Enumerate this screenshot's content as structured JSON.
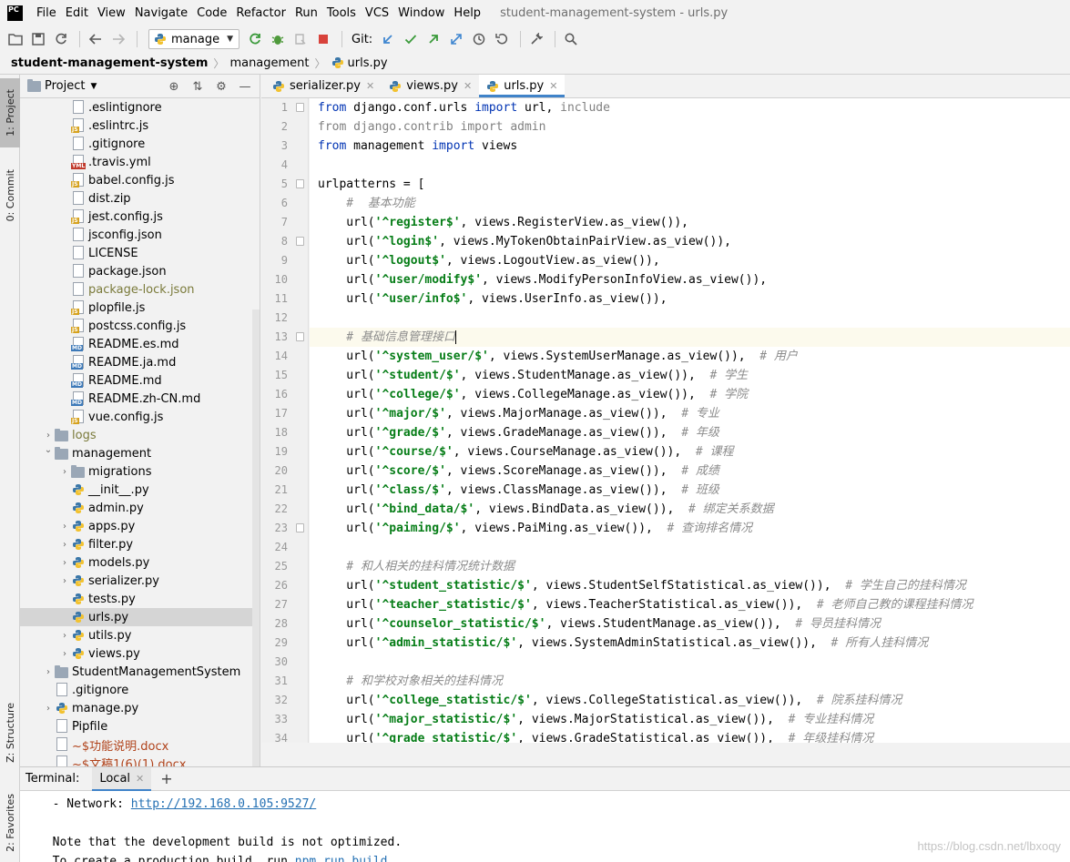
{
  "menu": {
    "logo_text": "PC",
    "items": [
      "File",
      "Edit",
      "View",
      "Navigate",
      "Code",
      "Refactor",
      "Run",
      "Tools",
      "VCS",
      "Window",
      "Help"
    ],
    "window_title": "student-management-system - urls.py"
  },
  "toolbar": {
    "run_config": "manage",
    "git_label": "Git:"
  },
  "breadcrumb": {
    "project": "student-management-system",
    "folder": "management",
    "file": "urls.py"
  },
  "left_stripe": {
    "project_tab": "1: Project",
    "commit_tab": "0: Commit",
    "structure_tab": "Z: Structure",
    "favorites_tab": "2: Favorites"
  },
  "project_panel": {
    "title": "Project",
    "rows": [
      {
        "name": ".eslintignore",
        "indent": 2,
        "kind": "file",
        "badge": "",
        "style": ""
      },
      {
        "name": ".eslintrc.js",
        "indent": 2,
        "kind": "file",
        "badge": "JS",
        "style": ""
      },
      {
        "name": ".gitignore",
        "indent": 2,
        "kind": "file",
        "badge": "",
        "style": ""
      },
      {
        "name": ".travis.yml",
        "indent": 2,
        "kind": "file",
        "badge": "YML",
        "style": ""
      },
      {
        "name": "babel.config.js",
        "indent": 2,
        "kind": "file",
        "badge": "JS",
        "style": ""
      },
      {
        "name": "dist.zip",
        "indent": 2,
        "kind": "file",
        "badge": "",
        "style": ""
      },
      {
        "name": "jest.config.js",
        "indent": 2,
        "kind": "file",
        "badge": "JS",
        "style": ""
      },
      {
        "name": "jsconfig.json",
        "indent": 2,
        "kind": "file",
        "badge": "",
        "style": ""
      },
      {
        "name": "LICENSE",
        "indent": 2,
        "kind": "file",
        "badge": "",
        "style": ""
      },
      {
        "name": "package.json",
        "indent": 2,
        "kind": "file",
        "badge": "",
        "style": ""
      },
      {
        "name": "package-lock.json",
        "indent": 2,
        "kind": "file",
        "badge": "",
        "style": "muted"
      },
      {
        "name": "plopfile.js",
        "indent": 2,
        "kind": "file",
        "badge": "JS",
        "style": ""
      },
      {
        "name": "postcss.config.js",
        "indent": 2,
        "kind": "file",
        "badge": "JS",
        "style": ""
      },
      {
        "name": "README.es.md",
        "indent": 2,
        "kind": "file",
        "badge": "MD",
        "style": ""
      },
      {
        "name": "README.ja.md",
        "indent": 2,
        "kind": "file",
        "badge": "MD",
        "style": ""
      },
      {
        "name": "README.md",
        "indent": 2,
        "kind": "file",
        "badge": "MD",
        "style": ""
      },
      {
        "name": "README.zh-CN.md",
        "indent": 2,
        "kind": "file",
        "badge": "MD",
        "style": ""
      },
      {
        "name": "vue.config.js",
        "indent": 2,
        "kind": "file",
        "badge": "JS",
        "style": ""
      },
      {
        "name": "logs",
        "indent": 1,
        "kind": "folder",
        "arrow": "›",
        "style": "muted"
      },
      {
        "name": "management",
        "indent": 1,
        "kind": "folder",
        "arrow": "⌄",
        "style": ""
      },
      {
        "name": "migrations",
        "indent": 2,
        "kind": "folder",
        "arrow": "›",
        "style": ""
      },
      {
        "name": "__init__.py",
        "indent": 2,
        "kind": "py",
        "style": ""
      },
      {
        "name": "admin.py",
        "indent": 2,
        "kind": "py",
        "style": ""
      },
      {
        "name": "apps.py",
        "indent": 2,
        "kind": "py",
        "arrow": "›",
        "style": ""
      },
      {
        "name": "filter.py",
        "indent": 2,
        "kind": "py",
        "arrow": "›",
        "style": ""
      },
      {
        "name": "models.py",
        "indent": 2,
        "kind": "py",
        "arrow": "›",
        "style": ""
      },
      {
        "name": "serializer.py",
        "indent": 2,
        "kind": "py",
        "arrow": "›",
        "style": ""
      },
      {
        "name": "tests.py",
        "indent": 2,
        "kind": "py",
        "style": ""
      },
      {
        "name": "urls.py",
        "indent": 2,
        "kind": "py",
        "style": "",
        "selected": true
      },
      {
        "name": "utils.py",
        "indent": 2,
        "kind": "py",
        "arrow": "›",
        "style": ""
      },
      {
        "name": "views.py",
        "indent": 2,
        "kind": "py",
        "arrow": "›",
        "style": ""
      },
      {
        "name": "StudentManagementSystem",
        "indent": 1,
        "kind": "folder",
        "arrow": "›",
        "style": ""
      },
      {
        "name": ".gitignore",
        "indent": 1,
        "kind": "file",
        "badge": "",
        "style": ""
      },
      {
        "name": "manage.py",
        "indent": 1,
        "kind": "py",
        "arrow": "›",
        "style": ""
      },
      {
        "name": "Pipfile",
        "indent": 1,
        "kind": "file",
        "badge": "",
        "style": ""
      },
      {
        "name": "~$功能说明.docx",
        "indent": 1,
        "kind": "file",
        "badge": "",
        "style": "red"
      },
      {
        "name": "~$文稿1(6)(1).docx",
        "indent": 1,
        "kind": "file",
        "badge": "",
        "style": "red"
      }
    ]
  },
  "editor": {
    "tabs": [
      {
        "label": "serializer.py",
        "active": false
      },
      {
        "label": "views.py",
        "active": false
      },
      {
        "label": "urls.py",
        "active": true
      }
    ],
    "current_line": 13,
    "fold_lines": [
      1,
      5,
      8,
      13,
      23
    ],
    "lines": [
      [
        {
          "t": "from",
          "c": "kw"
        },
        {
          "t": " django.conf.urls ",
          "c": ""
        },
        {
          "t": "import",
          "c": "kw"
        },
        {
          "t": " url, ",
          "c": ""
        },
        {
          "t": "include",
          "c": "dim"
        }
      ],
      [
        {
          "t": "from django.contrib import admin",
          "c": "dim"
        }
      ],
      [
        {
          "t": "from",
          "c": "kw"
        },
        {
          "t": " management ",
          "c": ""
        },
        {
          "t": "import",
          "c": "kw"
        },
        {
          "t": " views",
          "c": ""
        }
      ],
      [],
      [
        {
          "t": "urlpatterns = [",
          "c": ""
        }
      ],
      [
        {
          "t": "    #  基本功能",
          "c": "cmt"
        }
      ],
      [
        {
          "t": "    url(",
          "c": ""
        },
        {
          "t": "'^register$'",
          "c": "str"
        },
        {
          "t": ", views.RegisterView.as_view()),",
          "c": ""
        }
      ],
      [
        {
          "t": "    url(",
          "c": ""
        },
        {
          "t": "'^login$'",
          "c": "str"
        },
        {
          "t": ", views.MyTokenObtainPairView.as_view()),",
          "c": ""
        }
      ],
      [
        {
          "t": "    url(",
          "c": ""
        },
        {
          "t": "'^logout$'",
          "c": "str"
        },
        {
          "t": ", views.LogoutView.as_view()),",
          "c": ""
        }
      ],
      [
        {
          "t": "    url(",
          "c": ""
        },
        {
          "t": "'^user/modify$'",
          "c": "str"
        },
        {
          "t": ", views.ModifyPersonInfoView.as_view()),",
          "c": ""
        }
      ],
      [
        {
          "t": "    url(",
          "c": ""
        },
        {
          "t": "'^user/info$'",
          "c": "str"
        },
        {
          "t": ", views.UserInfo.as_view()),",
          "c": ""
        }
      ],
      [],
      [
        {
          "t": "    # 基础信息管理接口",
          "c": "cmt"
        }
      ],
      [
        {
          "t": "    url(",
          "c": ""
        },
        {
          "t": "'^system_user/$'",
          "c": "str"
        },
        {
          "t": ", views.SystemUserManage.as_view()),  ",
          "c": ""
        },
        {
          "t": "# 用户",
          "c": "cmt"
        }
      ],
      [
        {
          "t": "    url(",
          "c": ""
        },
        {
          "t": "'^student/$'",
          "c": "str"
        },
        {
          "t": ", views.StudentManage.as_view()),  ",
          "c": ""
        },
        {
          "t": "# 学生",
          "c": "cmt"
        }
      ],
      [
        {
          "t": "    url(",
          "c": ""
        },
        {
          "t": "'^college/$'",
          "c": "str"
        },
        {
          "t": ", views.CollegeManage.as_view()),  ",
          "c": ""
        },
        {
          "t": "# 学院",
          "c": "cmt"
        }
      ],
      [
        {
          "t": "    url(",
          "c": ""
        },
        {
          "t": "'^major/$'",
          "c": "str"
        },
        {
          "t": ", views.MajorManage.as_view()),  ",
          "c": ""
        },
        {
          "t": "# 专业",
          "c": "cmt"
        }
      ],
      [
        {
          "t": "    url(",
          "c": ""
        },
        {
          "t": "'^grade/$'",
          "c": "str"
        },
        {
          "t": ", views.GradeManage.as_view()),  ",
          "c": ""
        },
        {
          "t": "# 年级",
          "c": "cmt"
        }
      ],
      [
        {
          "t": "    url(",
          "c": ""
        },
        {
          "t": "'^course/$'",
          "c": "str"
        },
        {
          "t": ", views.CourseManage.as_view()),  ",
          "c": ""
        },
        {
          "t": "# 课程",
          "c": "cmt"
        }
      ],
      [
        {
          "t": "    url(",
          "c": ""
        },
        {
          "t": "'^score/$'",
          "c": "str"
        },
        {
          "t": ", views.ScoreManage.as_view()),  ",
          "c": ""
        },
        {
          "t": "# 成绩",
          "c": "cmt"
        }
      ],
      [
        {
          "t": "    url(",
          "c": ""
        },
        {
          "t": "'^class/$'",
          "c": "str"
        },
        {
          "t": ", views.ClassManage.as_view()),  ",
          "c": ""
        },
        {
          "t": "# 班级",
          "c": "cmt"
        }
      ],
      [
        {
          "t": "    url(",
          "c": ""
        },
        {
          "t": "'^bind_data/$'",
          "c": "str"
        },
        {
          "t": ", views.BindData.as_view()),  ",
          "c": ""
        },
        {
          "t": "# 绑定关系数据",
          "c": "cmt"
        }
      ],
      [
        {
          "t": "    url(",
          "c": ""
        },
        {
          "t": "'^paiming/$'",
          "c": "str"
        },
        {
          "t": ", views.PaiMing.as_view()),  ",
          "c": ""
        },
        {
          "t": "# 查询排名情况",
          "c": "cmt"
        }
      ],
      [],
      [
        {
          "t": "    # 和人相关的挂科情况统计数据",
          "c": "cmt"
        }
      ],
      [
        {
          "t": "    url(",
          "c": ""
        },
        {
          "t": "'^student_statistic/$'",
          "c": "str"
        },
        {
          "t": ", views.StudentSelfStatistical.as_view()),  ",
          "c": ""
        },
        {
          "t": "# 学生自己的挂科情况",
          "c": "cmt"
        }
      ],
      [
        {
          "t": "    url(",
          "c": ""
        },
        {
          "t": "'^teacher_statistic/$'",
          "c": "str"
        },
        {
          "t": ", views.TeacherStatistical.as_view()),  ",
          "c": ""
        },
        {
          "t": "# 老师自己教的课程挂科情况",
          "c": "cmt"
        }
      ],
      [
        {
          "t": "    url(",
          "c": ""
        },
        {
          "t": "'^counselor_statistic/$'",
          "c": "str"
        },
        {
          "t": ", views.StudentManage.as_view()),  ",
          "c": ""
        },
        {
          "t": "# 导员挂科情况",
          "c": "cmt"
        }
      ],
      [
        {
          "t": "    url(",
          "c": ""
        },
        {
          "t": "'^admin_statistic/$'",
          "c": "str"
        },
        {
          "t": ", views.SystemAdminStatistical.as_view()),  ",
          "c": ""
        },
        {
          "t": "# 所有人挂科情况",
          "c": "cmt"
        }
      ],
      [],
      [
        {
          "t": "    # 和学校对象相关的挂科情况",
          "c": "cmt"
        }
      ],
      [
        {
          "t": "    url(",
          "c": ""
        },
        {
          "t": "'^college_statistic/$'",
          "c": "str"
        },
        {
          "t": ", views.CollegeStatistical.as_view()),  ",
          "c": ""
        },
        {
          "t": "# 院系挂科情况",
          "c": "cmt"
        }
      ],
      [
        {
          "t": "    url(",
          "c": ""
        },
        {
          "t": "'^major_statistic/$'",
          "c": "str"
        },
        {
          "t": ", views.MajorStatistical.as_view()),  ",
          "c": ""
        },
        {
          "t": "# 专业挂科情况",
          "c": "cmt"
        }
      ],
      [
        {
          "t": "    url(",
          "c": ""
        },
        {
          "t": "'^grade_statistic/$'",
          "c": "str"
        },
        {
          "t": ", views.GradeStatistical.as_view()),  ",
          "c": ""
        },
        {
          "t": "# 年级挂科情况",
          "c": "cmt"
        }
      ]
    ]
  },
  "terminal": {
    "title": "Terminal:",
    "tab": "Local",
    "network_prefix": "  - Network: ",
    "network_url": "http://192.168.0.105:9527/",
    "note": "  Note that the development build is not optimized.",
    "prod_prefix": "  To create a production build, run ",
    "prod_cmd": "npm run build",
    "prod_suffix": "."
  },
  "watermark": "https://blog.csdn.net/lbxoqy",
  "colors": {
    "accent": "#4083c9",
    "keyword": "#0033b3",
    "string": "#067d17",
    "comment": "#8c8c8c"
  }
}
